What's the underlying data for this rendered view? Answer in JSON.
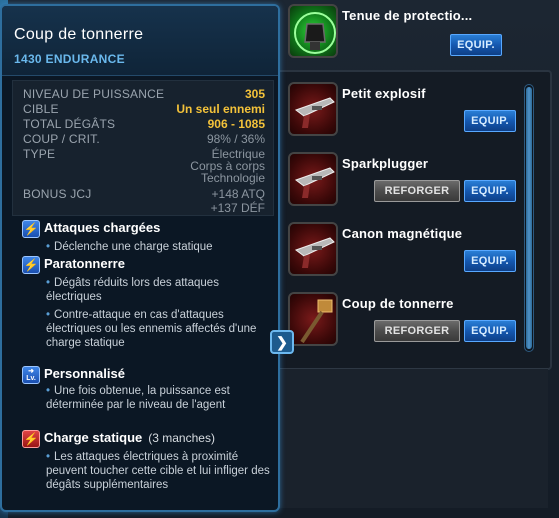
{
  "tooltip": {
    "title": "Coup de tonnerre",
    "endurance": "1430 ENDURANCE",
    "stats": [
      {
        "label": "NIVEAU DE PUISSANCE",
        "value": "305",
        "style": "yellow"
      },
      {
        "label": "CIBLE",
        "value": "Un seul ennemi",
        "style": "yellow"
      },
      {
        "label": "TOTAL DÉGÂTS",
        "value": "906 - 1085",
        "style": "yellow"
      },
      {
        "label": "COUP / CRIT.",
        "value": "98% / 36%",
        "style": "grey"
      },
      {
        "label": "TYPE",
        "value": [
          "Électrique",
          "Corps à corps",
          "Technologie"
        ],
        "style": "grey"
      },
      {
        "label": "BONUS JCJ",
        "value": [
          "+148 ATQ",
          "+137 DÉF"
        ],
        "style": "grey"
      }
    ],
    "perks": [
      {
        "icon": "lightning-icon",
        "name": "Attaques chargées",
        "suffix": "",
        "lines": [
          "Déclenche une charge statique"
        ]
      },
      {
        "icon": "lightning-icon",
        "name": "Paratonnerre",
        "suffix": "",
        "lines": [
          "Dégâts réduits lors des attaques électriques",
          "Contre-attaque en cas d'attaques électriques ou les ennemis affectés d'une charge statique"
        ]
      },
      {
        "icon": "level-icon",
        "name": "Personnalisé",
        "suffix": "",
        "lines": [
          "Une fois obtenue, la puissance est déterminée par le niveau de l'agent"
        ]
      },
      {
        "icon": "lightning-red-icon",
        "name": "Charge statique",
        "suffix": "(3 manches)",
        "lines": [
          "Les attaques électriques à proximité peuvent toucher cette cible et lui infliger des dégâts supplémentaires"
        ]
      }
    ],
    "level_icon_text": "Lv."
  },
  "items": [
    {
      "name": "Tenue de protectio...",
      "reforge": "",
      "equip": "EQUIP.",
      "thumb": "armor"
    },
    {
      "name": "Petit explosif",
      "reforge": "",
      "equip": "EQUIP.",
      "thumb": "gun"
    },
    {
      "name": "Sparkplugger",
      "reforge": "REFORGER",
      "equip": "EQUIP.",
      "thumb": "gun"
    },
    {
      "name": "Canon magnétique",
      "reforge": "",
      "equip": "EQUIP.",
      "thumb": "gun"
    },
    {
      "name": "Coup de tonnerre",
      "reforge": "REFORGER",
      "equip": "EQUIP.",
      "thumb": "hammer"
    }
  ],
  "colors": {
    "accent_blue": "#6ab8ec",
    "stat_yellow": "#f3c23a",
    "equip_blue": "#1558b0"
  }
}
